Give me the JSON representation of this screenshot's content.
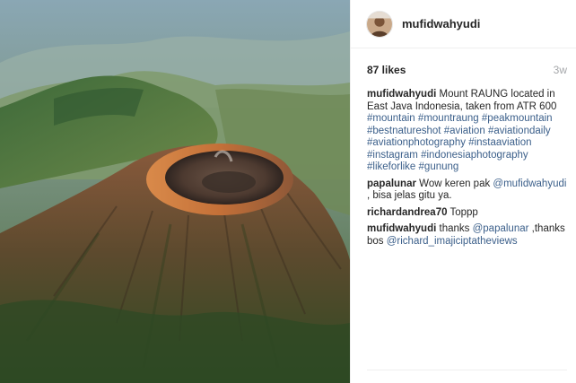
{
  "post": {
    "username": "mufidwahyudi",
    "likes": "87 likes",
    "time_ago": "3w",
    "image_alt_icon": "volcano-photo",
    "caption": {
      "user": "mufidwahyudi",
      "text": "Mount RAUNG located in East Java Indonesia, taken from ATR 600",
      "hashtags": [
        "#mountain",
        "#mountraung",
        "#peakmountain",
        "#bestnatureshot",
        "#aviation",
        "#aviationdaily",
        "#aviationphotography",
        "#instaaviation",
        "#instagram",
        "#indonesiaphotography",
        "#likeforlike",
        "#gunung"
      ]
    },
    "comments": [
      {
        "user": "papalunar",
        "pre": "Wow keren pak",
        "mention": "@mufidwahyudi",
        "post": ", bisa jelas gitu ya."
      },
      {
        "user": "richardandrea70",
        "pre": "Toppp",
        "mention": "",
        "post": ""
      },
      {
        "user": "mufidwahyudi",
        "pre": "thanks",
        "mention": "@papalunar",
        "post": ",thanks bos",
        "mention2": "@richard_imajiciptatheviews"
      }
    ]
  },
  "colors": {
    "link": "#3b5f8a",
    "muted": "#a5a7aa",
    "text": "#262626",
    "divider": "#efefef"
  }
}
